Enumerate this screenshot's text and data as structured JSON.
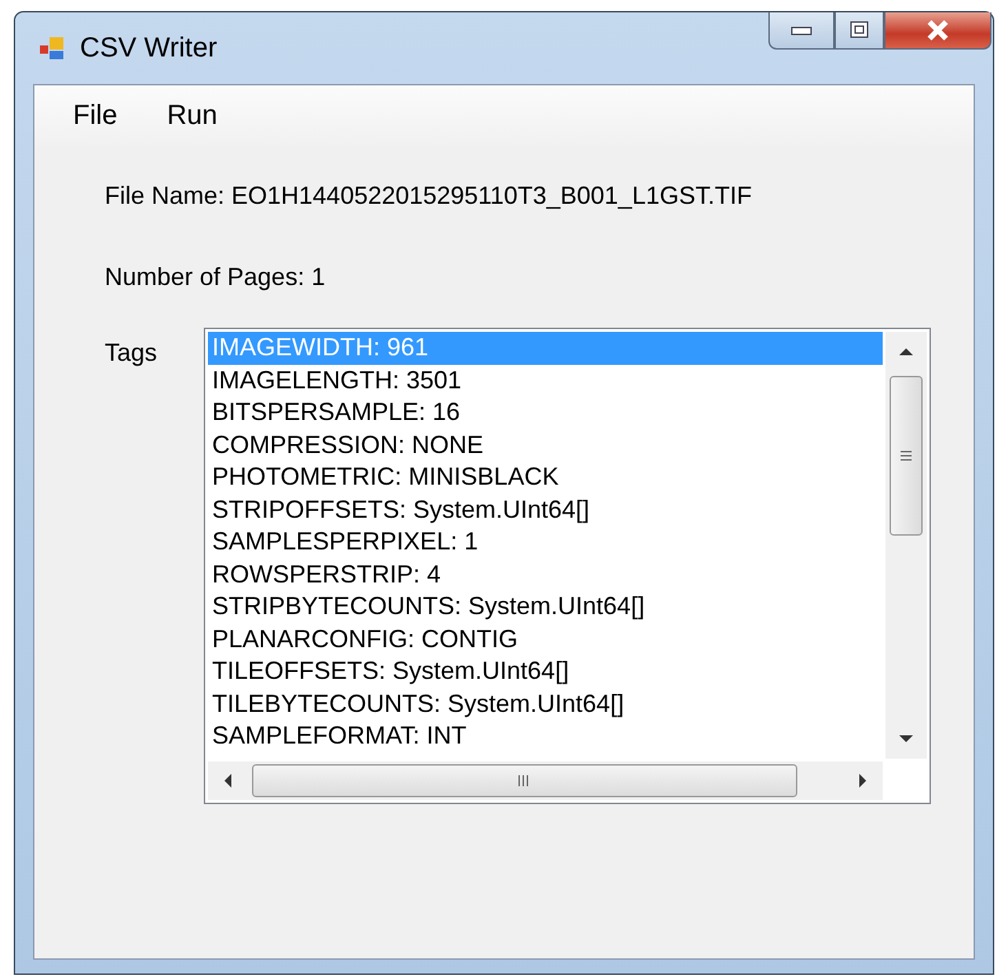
{
  "window": {
    "title": "CSV Writer"
  },
  "menu": [
    {
      "label": "File"
    },
    {
      "label": "Run"
    }
  ],
  "file_name": "File Name: EO1H1440522015295110T3_B001_L1GST.TIF",
  "pages": "Number of Pages: 1",
  "tags": {
    "label": "Tags",
    "items": [
      {
        "text": "IMAGEWIDTH: 961",
        "selected": true
      },
      {
        "text": "IMAGELENGTH: 3501",
        "selected": false
      },
      {
        "text": "BITSPERSAMPLE: 16",
        "selected": false
      },
      {
        "text": "COMPRESSION: NONE",
        "selected": false
      },
      {
        "text": "PHOTOMETRIC: MINISBLACK",
        "selected": false
      },
      {
        "text": "STRIPOFFSETS: System.UInt64[]",
        "selected": false
      },
      {
        "text": "SAMPLESPERPIXEL: 1",
        "selected": false
      },
      {
        "text": "ROWSPERSTRIP: 4",
        "selected": false
      },
      {
        "text": "STRIPBYTECOUNTS: System.UInt64[]",
        "selected": false
      },
      {
        "text": "PLANARCONFIG: CONTIG",
        "selected": false
      },
      {
        "text": "TILEOFFSETS: System.UInt64[]",
        "selected": false
      },
      {
        "text": "TILEBYTECOUNTS: System.UInt64[]",
        "selected": false
      },
      {
        "text": "SAMPLEFORMAT: INT",
        "selected": false
      }
    ]
  }
}
